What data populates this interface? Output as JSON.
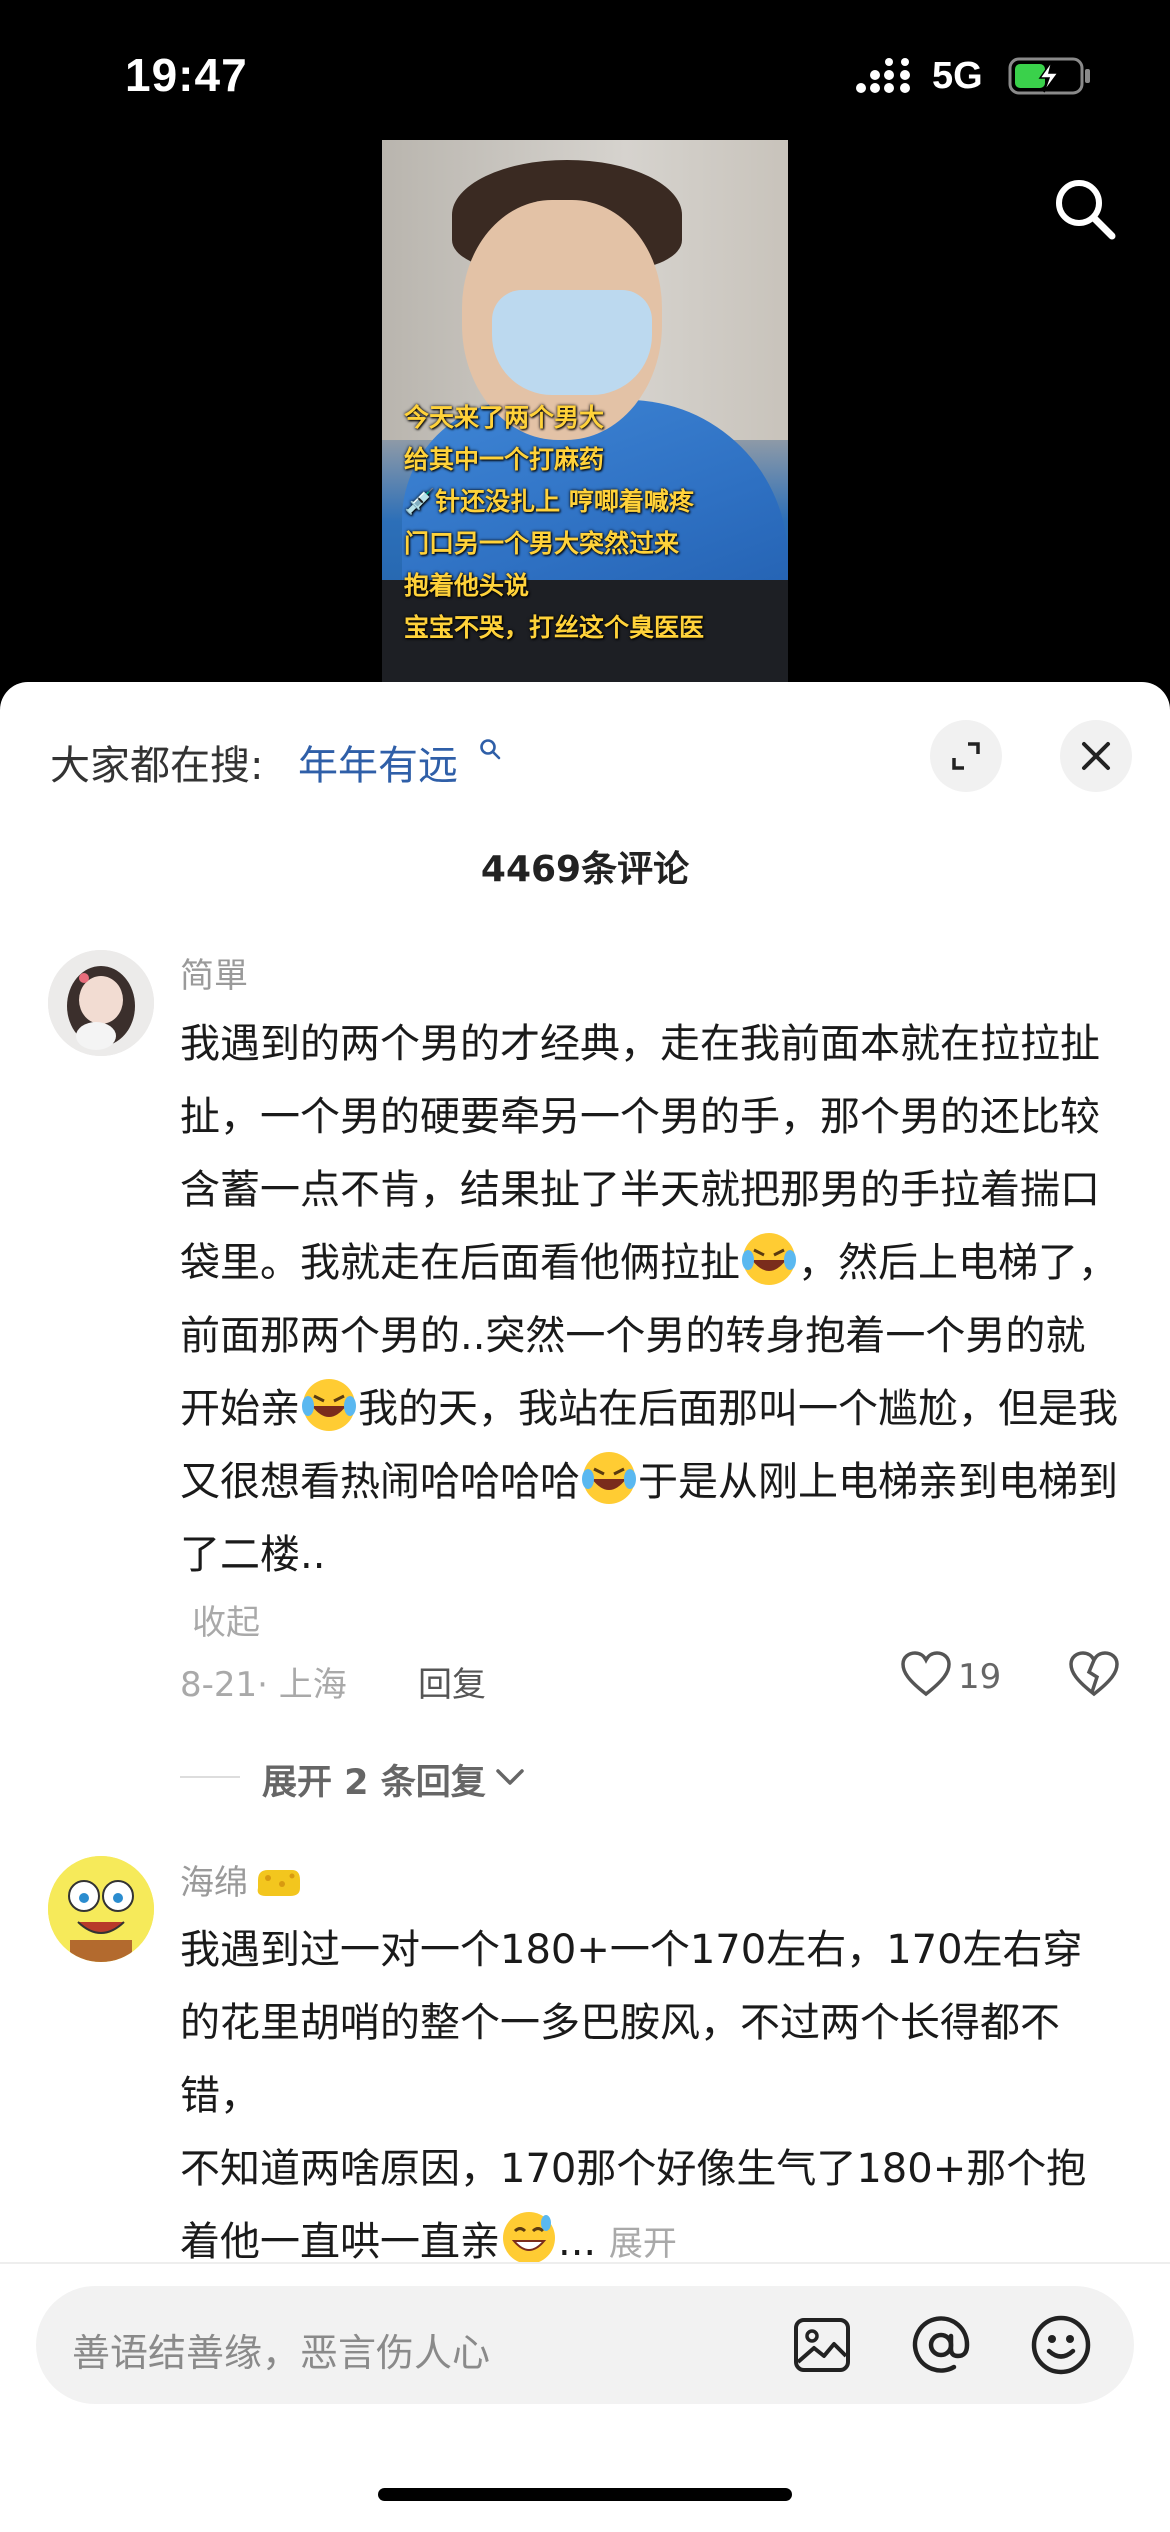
{
  "status_bar": {
    "time": "19:47",
    "network": "5G"
  },
  "video": {
    "caption_lines": [
      "今天来了两个男大",
      "给其中一个打麻药",
      "💉针还没扎上 哼唧着喊疼",
      "门口另一个男大突然过来",
      "抱着他头说",
      "宝宝不哭，打丝这个臭医医"
    ]
  },
  "hot_search": {
    "label": "大家都在搜:",
    "query": "年年有远"
  },
  "comments_header": {
    "count": "4469条评论"
  },
  "comments": [
    {
      "user": "简單",
      "text_parts": [
        "我遇到的两个男的才经典，走在我前面本就在拉拉扯扯，一个男的硬要牵另一个男的手，那个男的还比较含蓄一点不肯，结果扯了半天就把那男的手拉着揣口袋里。我就走在后面看他俩拉扯",
        "，然后上电梯了，前面那两个男的..突然一个男的转身抱着一个男的就开始亲",
        "我的天，我站在后面那叫一个尴尬，但是我又很想看热闹哈哈哈哈",
        "于是从刚上电梯亲到电梯到了二楼.."
      ],
      "collapse_label": "收起",
      "meta": "8-21· 上海",
      "reply_label": "回复",
      "likes": "19",
      "expand_replies": "展开 2 条回复"
    },
    {
      "user": "海绵",
      "text_parts": [
        "我遇到过一对一个180+一个170左右，170左右穿的花里胡哨的整个一多巴胺风，不过两个长得都不错，",
        "不知道两啥原因，170那个好像生气了180+那个抱着他一直哄一直亲",
        "..."
      ],
      "more_label": "展开"
    }
  ],
  "input": {
    "placeholder": "善语结善缘，恶言伤人心"
  },
  "colors": {
    "link": "#2f5fa8",
    "caption": "#ffd23a"
  }
}
